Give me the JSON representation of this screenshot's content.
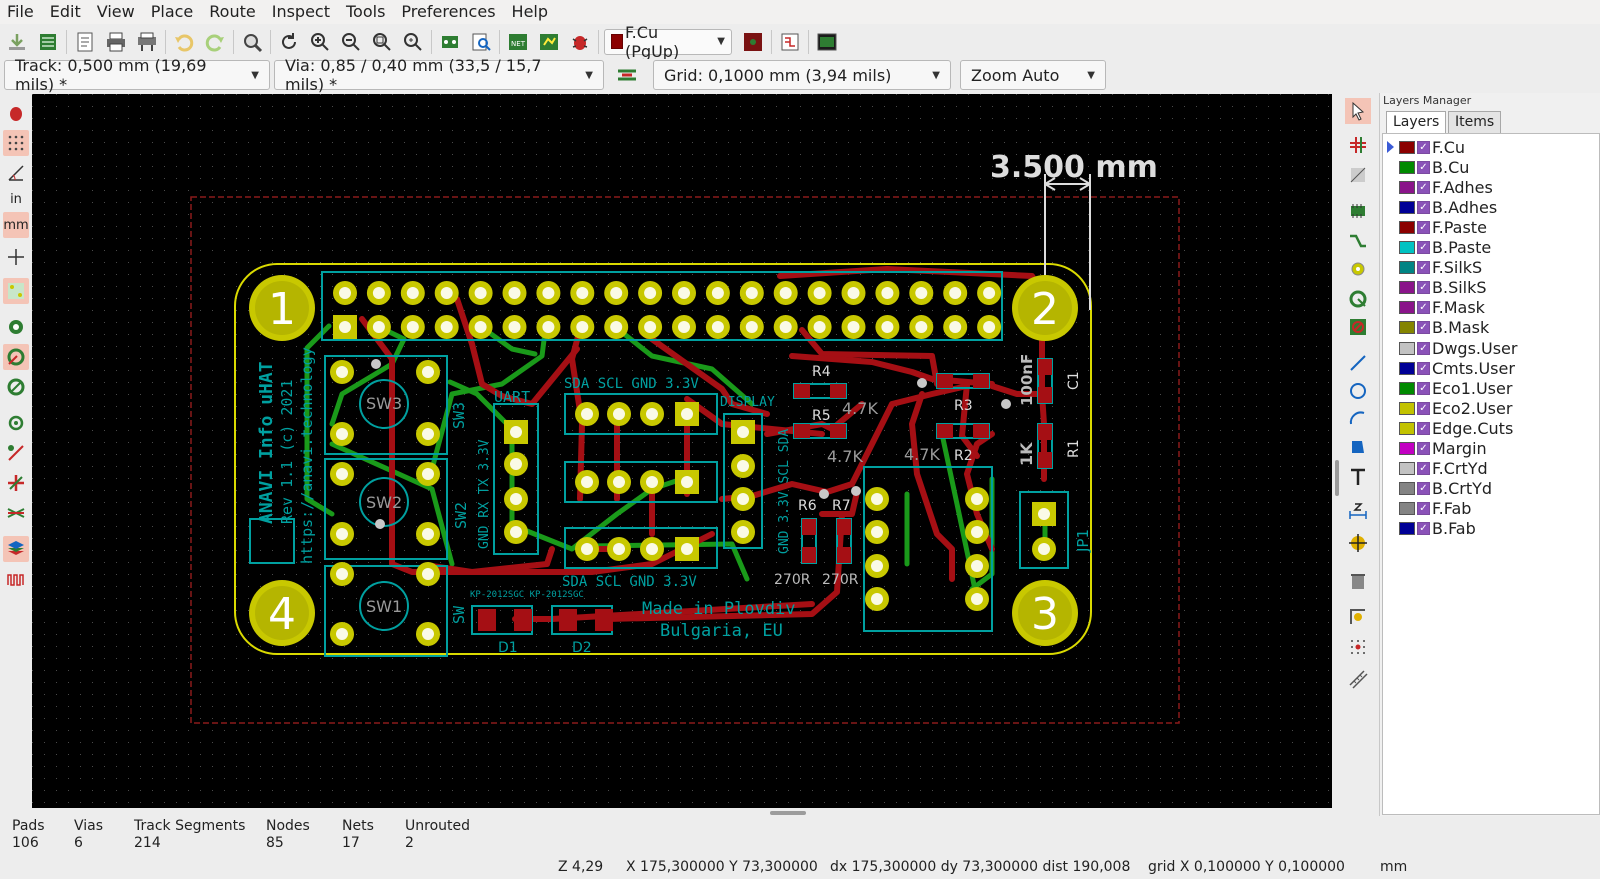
{
  "menu": [
    "File",
    "Edit",
    "View",
    "Place",
    "Route",
    "Inspect",
    "Tools",
    "Preferences",
    "Help"
  ],
  "toolbar": {
    "active_layer": "F.Cu (PgUp)",
    "track": "Track: 0,500 mm (19,69 mils) *",
    "via": "Via: 0,85 / 0,40 mm (33,5 / 15,7 mils) *",
    "grid": "Grid: 0,1000 mm (3,94 mils)",
    "zoom": "Zoom Auto"
  },
  "board": {
    "dimension_text": "3.500 mm",
    "hole_labels": [
      "1",
      "2",
      "3",
      "4"
    ],
    "silk_title": "ANAVI Info uHAT",
    "silk_rev": "Rev 1.1 (c) 2021",
    "silk_url": "https://anavi.technology",
    "silk_made": "Made in Plovdiv",
    "silk_country": "Bulgaria, EU",
    "i2c_top": "SDA SCL GND 3.3V",
    "i2c_bottom": "SDA SCL GND 3.3V",
    "uart": "UART",
    "uart_pins": "GND RX TX 3.3V",
    "display": "DISPLAY",
    "display_pins": "GND 3.3V SCL SDA",
    "switches": [
      "SW3",
      "SW2",
      "SW1"
    ],
    "sw_sides": [
      "SW3",
      "SW2",
      "SW"
    ],
    "refs": [
      "R4",
      "R5",
      "R3",
      "R2",
      "R6",
      "R7",
      "C1",
      "R1",
      "JP1",
      "D1",
      "D2"
    ],
    "values": [
      "4.7K",
      "4.7K",
      "4.7K",
      "100nF",
      "1K",
      "270R",
      "270R"
    ],
    "misc": "KP-2012SGC  KP-2012SGC"
  },
  "left_tools": [
    "drc-icon",
    "grid-icon",
    "polar-icon",
    "inch-icon",
    "mm-icon",
    "cursor-icon",
    "pads-icon",
    "fill-zone-icon",
    "zone-outline-icon",
    "zone-ratsnest-icon",
    "via-icon",
    "ratsnest-icon",
    "high-contrast-icon",
    "layers-icon",
    "microwave-icon",
    "length-icon"
  ],
  "left_tool_text": {
    "in": "in",
    "mm": "mm"
  },
  "layers_manager": {
    "title": "Layers Manager",
    "tabs": [
      "Layers",
      "Items"
    ],
    "layers": [
      {
        "name": "F.Cu",
        "color": "#8b0000"
      },
      {
        "name": "B.Cu",
        "color": "#008a00"
      },
      {
        "name": "F.Adhes",
        "color": "#8a148a"
      },
      {
        "name": "B.Adhes",
        "color": "#000096"
      },
      {
        "name": "F.Paste",
        "color": "#8b0000"
      },
      {
        "name": "B.Paste",
        "color": "#00c2c2"
      },
      {
        "name": "F.SilkS",
        "color": "#008484"
      },
      {
        "name": "B.SilkS",
        "color": "#8a148a"
      },
      {
        "name": "F.Mask",
        "color": "#8a148a"
      },
      {
        "name": "B.Mask",
        "color": "#848400"
      },
      {
        "name": "Dwgs.User",
        "color": "#c2c2c2"
      },
      {
        "name": "Cmts.User",
        "color": "#000096"
      },
      {
        "name": "Eco1.User",
        "color": "#008a00"
      },
      {
        "name": "Eco2.User",
        "color": "#c2c200"
      },
      {
        "name": "Edge.Cuts",
        "color": "#c2c200"
      },
      {
        "name": "Margin",
        "color": "#c200c2"
      },
      {
        "name": "F.CrtYd",
        "color": "#c2c2c2"
      },
      {
        "name": "B.CrtYd",
        "color": "#848484"
      },
      {
        "name": "F.Fab",
        "color": "#848484"
      },
      {
        "name": "B.Fab",
        "color": "#000096"
      }
    ]
  },
  "stats": {
    "pads": {
      "label": "Pads",
      "value": "106"
    },
    "vias": {
      "label": "Vias",
      "value": "6"
    },
    "tracks": {
      "label": "Track Segments",
      "value": "214"
    },
    "nodes": {
      "label": "Nodes",
      "value": "85"
    },
    "nets": {
      "label": "Nets",
      "value": "17"
    },
    "unrouted": {
      "label": "Unrouted",
      "value": "2"
    }
  },
  "coords": {
    "zoom": "Z 4,29",
    "xy": "X 175,300000  Y 73,300000",
    "dxdy": "dx 175,300000  dy 73,300000  dist 190,008",
    "grid": "grid X 0,100000  Y 0,100000",
    "units": "mm"
  },
  "colors": {
    "fcu": "#a50f14",
    "bcu": "#1a9a1a",
    "silk": "#00a0a0",
    "edge": "#dada00",
    "pad": "#c8c800",
    "keepout": "#8b1a1a"
  }
}
